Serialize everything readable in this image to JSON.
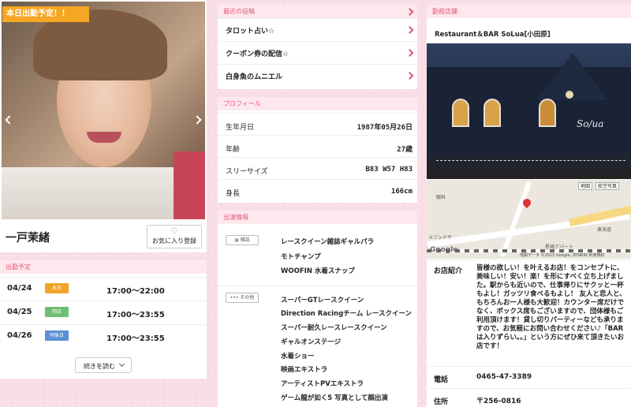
{
  "left": {
    "banner": "本日出勤予定！！",
    "name": "一戸茉緒",
    "favorite_button": "お気に入り登録",
    "schedule_header": "出勤予定",
    "schedule": [
      {
        "date": "04/24",
        "badge": "本日",
        "badge_color": "#f0a526",
        "time": "17:00〜22:00"
      },
      {
        "date": "04/25",
        "badge": "明日",
        "badge_color": "#6fbf73",
        "time": "17:00〜23:55"
      },
      {
        "date": "04/26",
        "badge": "明後日",
        "badge_color": "#5b8fd6",
        "time": "17:00〜23:55"
      }
    ],
    "more_button": "続きを読む"
  },
  "middle": {
    "recent_header": "最近の投稿",
    "posts": [
      "タロット占い☆",
      "クーポン券の配信☆",
      "白身魚のムニエル"
    ],
    "profile_header": "プロフィール",
    "profile": [
      {
        "key": "生年月日",
        "value": "1987年05月26日"
      },
      {
        "key": "年齢",
        "value": "27歳"
      },
      {
        "key": "スリーサイズ",
        "value": "B83 W57 H83"
      },
      {
        "key": "身長",
        "value": "166cm"
      }
    ],
    "appearance_header": "出演情報",
    "magazine_tag": "雑誌",
    "magazines": [
      "レースクイーン雑誌ギャルパラ",
      "モトチャンプ",
      "WOOFIN 水着スナップ"
    ],
    "other_tag": "その他",
    "others": [
      "スーパーGTレースクイーン",
      "Direction Racingチーム レースクイーン",
      "スーパー耐久レースレースクイーン",
      "ギャルオンステージ",
      "水着ショー",
      "映画エキストラ",
      "アーティストPVエキストラ",
      "ゲーム龍が如く5 写真として顔出演"
    ]
  },
  "right": {
    "shop_header": "勤務店舗",
    "shop_name": "Restaurant＆BAR SoLua[小田原]",
    "map_buttons": [
      "地図",
      "航空写真"
    ],
    "map_labels": [
      "東海道",
      "眼科",
      "メゾンドサ",
      "星崎アパート",
      "Google",
      "地図データ ©2015 Google, ZENRIN 利用規約"
    ],
    "intro_key": "お店紹介",
    "intro_text": "皆様の欲しい！を叶えるお店！をコンセプトに、美味しい！安い！楽！を形にすべく立ち上げました。駅からも近いので、仕事帰りにサクッと一杯もよし！ガッツリ食べるもよし！ 友人と恋人と、もちろんお一人様も大歓迎！カウンター席だけでなく、ボックス席もございますので、団体様もご利用頂けます！貸し切りパーティーなども承りますので、お気軽にお問い合わせください♪「BARは入りずらい。。」という方にぜひ来て頂きたいお店です！",
    "tel_key": "電話",
    "tel_value": "0465-47-3389",
    "addr_key": "住所",
    "addr_value": "〒256-0816"
  }
}
